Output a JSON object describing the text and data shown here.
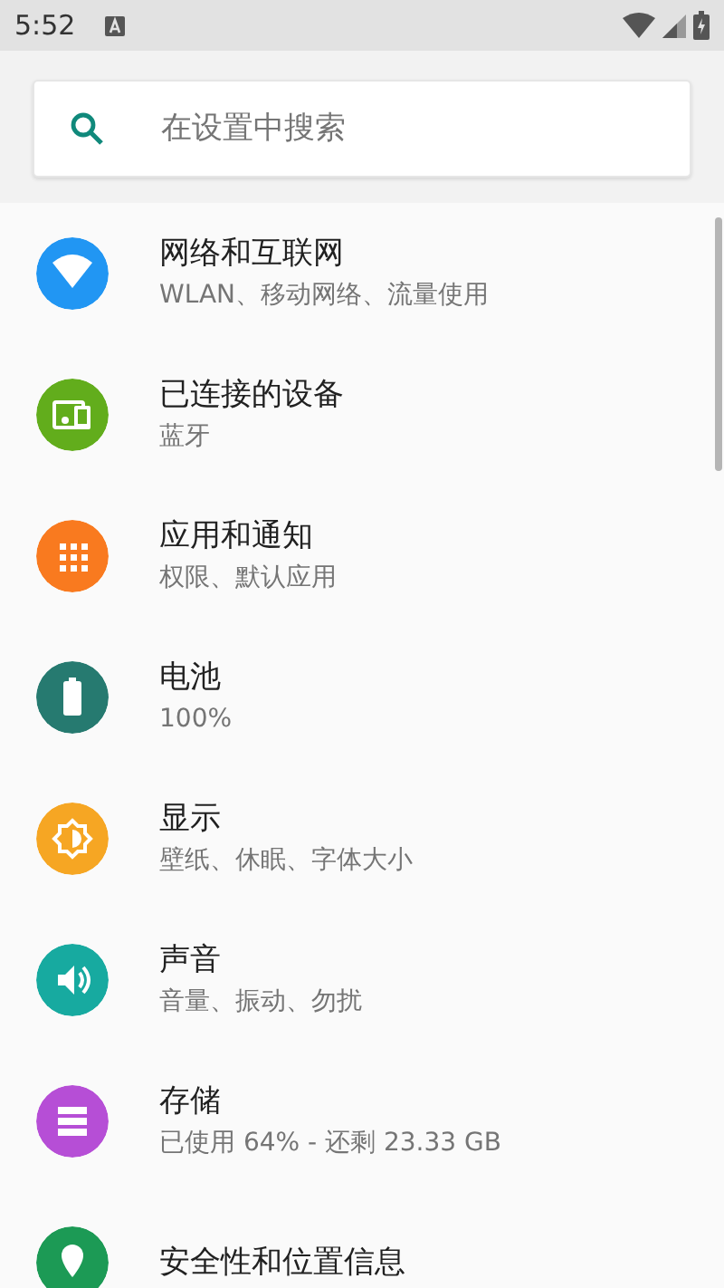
{
  "status_bar": {
    "time": "5:52"
  },
  "search": {
    "placeholder": "在设置中搜索"
  },
  "items": [
    {
      "title": "网络和互联网",
      "subtitle": "WLAN、移动网络、流量使用",
      "color": "#2196f3"
    },
    {
      "title": "已连接的设备",
      "subtitle": "蓝牙",
      "color": "#62ad1c"
    },
    {
      "title": "应用和通知",
      "subtitle": "权限、默认应用",
      "color": "#f97a1f"
    },
    {
      "title": "电池",
      "subtitle": "100%",
      "color": "#267a70"
    },
    {
      "title": "显示",
      "subtitle": "壁纸、休眠、字体大小",
      "color": "#f6a623"
    },
    {
      "title": "声音",
      "subtitle": "音量、振动、勿扰",
      "color": "#17aaa0"
    },
    {
      "title": "存储",
      "subtitle": "已使用 64% - 还剩 23.33 GB",
      "color": "#b64ed6"
    },
    {
      "title": "安全性和位置信息",
      "color": "#1c9a55"
    }
  ]
}
